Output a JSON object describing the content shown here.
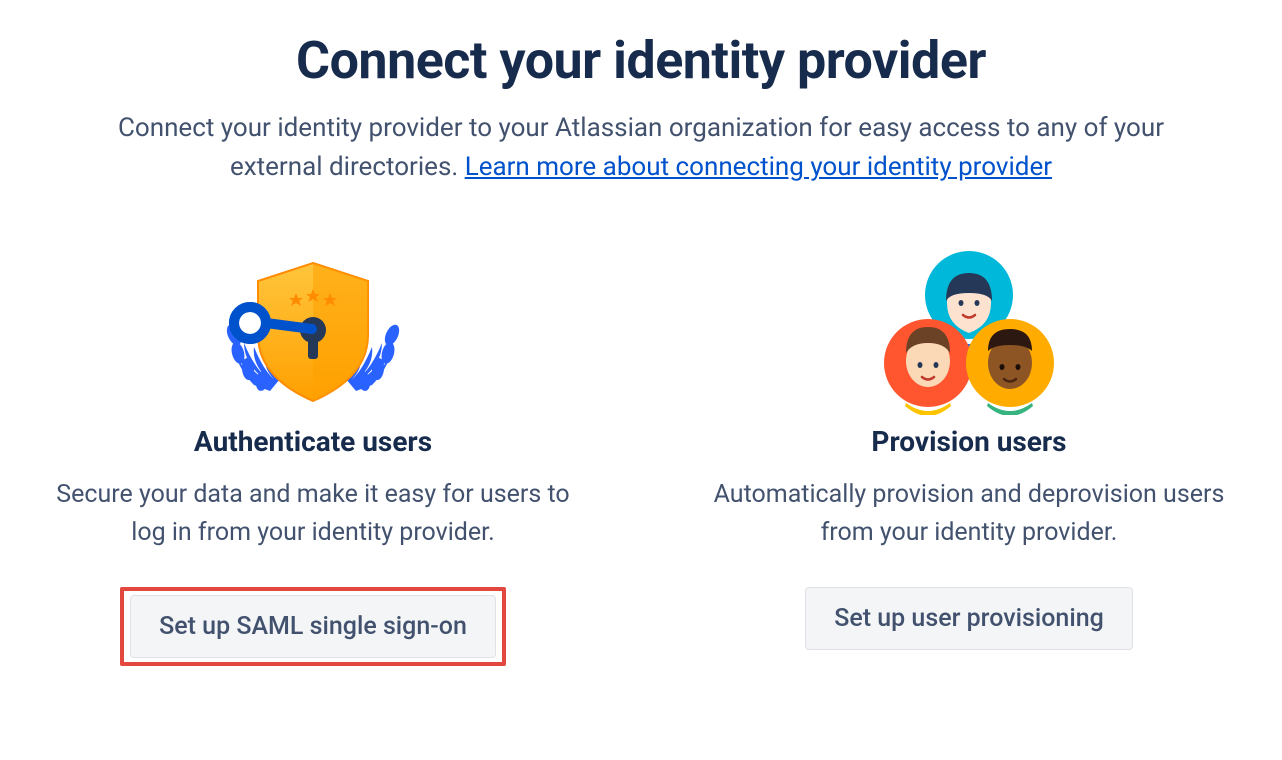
{
  "header": {
    "title": "Connect your identity provider",
    "subtitle_pre": "Connect your identity provider to your Atlassian organization for easy access to any of your external directories. ",
    "subtitle_link": "Learn more about connecting your identity provider"
  },
  "cards": {
    "auth": {
      "title": "Authenticate users",
      "desc": "Secure your data and make it easy for users to log in from your identity provider.",
      "button": "Set up SAML single sign-on"
    },
    "provision": {
      "title": "Provision users",
      "desc": "Automatically provision and deprovision users from your identity provider.",
      "button": "Set up user provisioning"
    }
  }
}
